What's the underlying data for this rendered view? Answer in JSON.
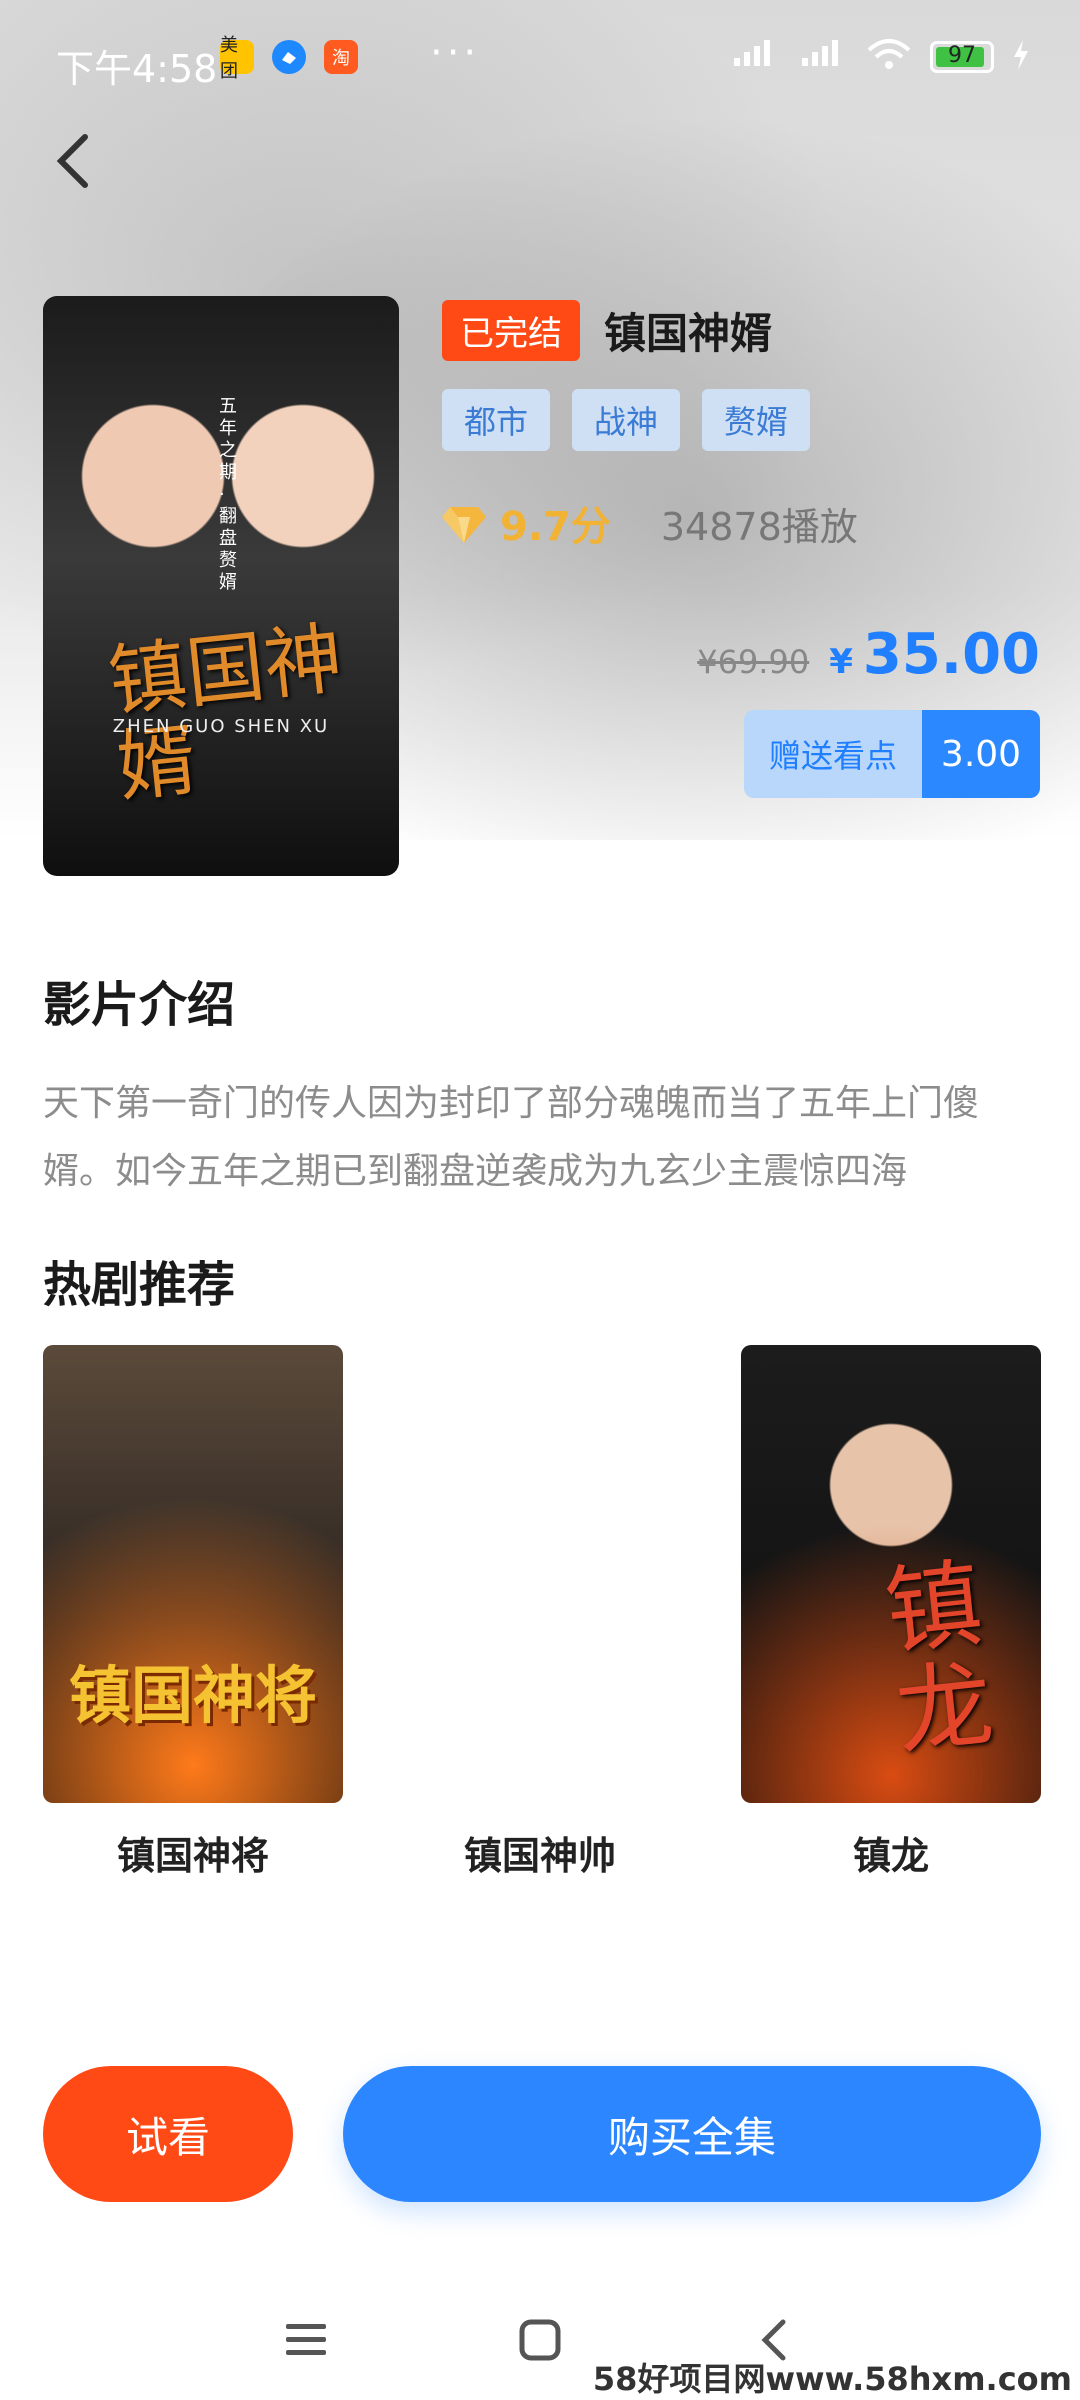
{
  "status_bar": {
    "time": "下午4:58",
    "app_badges": [
      "美团",
      "",
      "淘"
    ],
    "dots": "···",
    "battery": "97"
  },
  "drama": {
    "poster_title": "镇国神婿",
    "poster_subtitle": "ZHEN GUO SHEN XU",
    "poster_tagline": "五年之期·翻盘赘婿",
    "status_badge": "已完结",
    "title": "镇国神婿",
    "tags": [
      "都市",
      "战神",
      "赘婿"
    ],
    "score": "9.7分",
    "plays": "34878播放",
    "original_price": "¥69.90",
    "price_symbol": "¥",
    "price": "35.00",
    "bonus_label": "赠送看点",
    "bonus_value": "3.00"
  },
  "intro": {
    "heading": "影片介绍",
    "text": "天下第一奇门的传人因为封印了部分魂魄而当了五年上门傻婿。如今五年之期已到翻盘逆袭成为九玄少主震惊四海"
  },
  "recommend": {
    "heading": "热剧推荐",
    "items": [
      {
        "name": "镇国神将",
        "cover_text": "镇国神将"
      },
      {
        "name": "镇国神帅",
        "cover_text": ""
      },
      {
        "name": "镇龙",
        "cover_text": "镇龙"
      }
    ]
  },
  "actions": {
    "trial_label": "试看",
    "buy_label": "购买全集"
  },
  "watermark": "58好项目网www.58hxm.com",
  "colors": {
    "accent_blue": "#2b86ff",
    "accent_orange": "#ff4a16",
    "gold": "#f2b233"
  }
}
